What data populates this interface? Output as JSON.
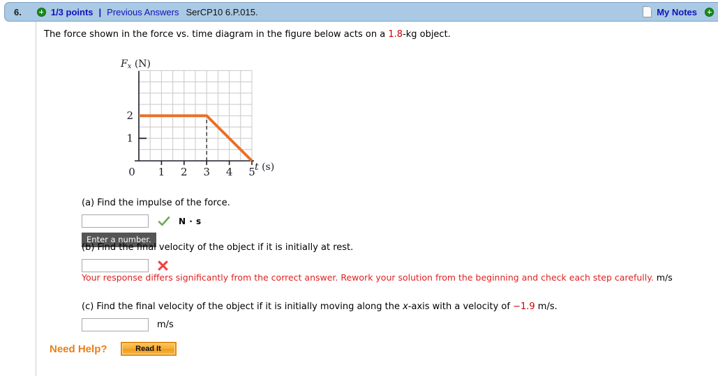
{
  "header": {
    "question_number": "6.",
    "points": "1/3 points",
    "separator": "|",
    "previous_answers": "Previous Answers",
    "problem_code": "SerCP10 6.P.015.",
    "my_notes": "My Notes",
    "plus_icon_left": "plus-circle-icon",
    "plus_icon_right": "plus-circle-icon",
    "note_icon": "note-page-icon",
    "bar_color": "#a9c9e4",
    "link_color": "#1111bb"
  },
  "prompt": {
    "text_before": "The force shown in the force vs. time diagram in the figure below acts on a ",
    "mass_value": "1.8",
    "text_after": "-kg object.",
    "highlight_color": "#cc0000"
  },
  "chart_data": {
    "type": "line",
    "title": "",
    "xlabel": "t (s)",
    "xlabel_symbol": "t",
    "xlabel_unit": "(s)",
    "ylabel": "Fx (N)",
    "ylabel_symbol": "F",
    "ylabel_subscript": "x",
    "ylabel_unit": "(N)",
    "x": [
      0,
      3,
      5
    ],
    "y": [
      2,
      2,
      0
    ],
    "xlim": [
      0,
      5.5
    ],
    "ylim": [
      0,
      3
    ],
    "xticks": [
      0,
      1,
      2,
      3,
      4,
      5
    ],
    "xticklabels": [
      "0",
      "1",
      "2",
      "3",
      "4",
      "5"
    ],
    "yticks": [
      1,
      2
    ],
    "yticklabels": [
      "1",
      "2"
    ],
    "grid": true,
    "grid_color": "#c8c8c8",
    "line_color": "#e8702a",
    "line_width": 4,
    "annotations": [
      {
        "type": "dashed-vline",
        "x": 3,
        "y_from": 0,
        "y_to": 2,
        "color": "#222222"
      }
    ],
    "legend": null
  },
  "parts": [
    {
      "id": "a",
      "question": "(a) Find the impulse of the force.",
      "input_value": "",
      "input_placeholder": "",
      "status": "correct",
      "status_icon": "green-check-icon",
      "units": "N · s",
      "tooltip": "Enter a number."
    },
    {
      "id": "b",
      "question": "(b) Find the final velocity of the object if it is initially at rest.",
      "input_value": "",
      "input_placeholder": "",
      "status": "incorrect",
      "status_icon": "red-x-icon",
      "units": "",
      "error_message": "Your response differs significantly from the correct answer. Rework your solution from the beginning and check each step carefully.",
      "error_trailing_unit": "m/s",
      "error_color": "#e02020"
    },
    {
      "id": "c",
      "question_part1": "(c) Find the final velocity of the object if it is initially moving along the ",
      "question_italic": "x",
      "question_part2": "-axis with a velocity of ",
      "velocity_value": "−1.9",
      "question_part3": " m/s.",
      "input_value": "",
      "input_placeholder": "",
      "status": "none",
      "units": "m/s"
    }
  ],
  "need_help": {
    "label": "Need Help?",
    "button_label": "Read It",
    "label_color": "#e8801a",
    "button_color": "#f7ad33"
  }
}
